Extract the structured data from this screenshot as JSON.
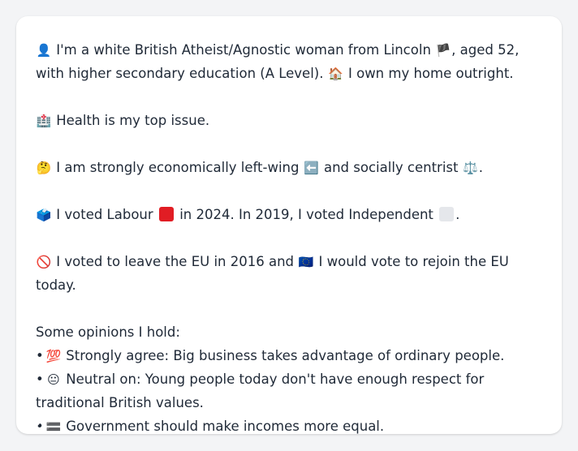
{
  "profile": {
    "intro_emoji": "👤",
    "intro_text": "I'm a white British Atheist/Agnostic woman from Lincoln",
    "flag_emoji": "🏴",
    "intro_text_2": ", aged 52, with higher secondary education (A Level).",
    "home_emoji": "🏠",
    "home_text": "I own my home outright."
  },
  "health": {
    "emoji": "🏥",
    "text": "Health is my top issue."
  },
  "ideology": {
    "emoji": "🤔",
    "text_1": "I am strongly economically left-wing",
    "left_emoji": "⬅️",
    "text_2": "and socially centrist",
    "scale_emoji": "⚖️",
    "text_3": "."
  },
  "voting": {
    "emoji": "🗳️",
    "text_1": "I voted Labour",
    "labour_color": "#e11d24",
    "text_2": "in 2024. In 2019, I voted Independent",
    "independent_color": "#e5e7eb",
    "text_3": "."
  },
  "eu": {
    "emoji": "🚫",
    "text_1": "I voted to leave the EU in 2016 and",
    "eu_emoji": "🇪🇺",
    "text_2": "I would vote to rejoin the EU today."
  },
  "opinions": {
    "title": "Some opinions I hold:",
    "bullet": "•",
    "items": [
      {
        "emoji": "💯",
        "text": "Strongly agree: Big business takes advantage of ordinary people."
      },
      {
        "emoji": "😐",
        "text": "Neutral on: Young people today don't have enough respect for traditional British values."
      },
      {
        "emoji": "🟰",
        "text": "Government should make incomes more equal."
      }
    ]
  }
}
